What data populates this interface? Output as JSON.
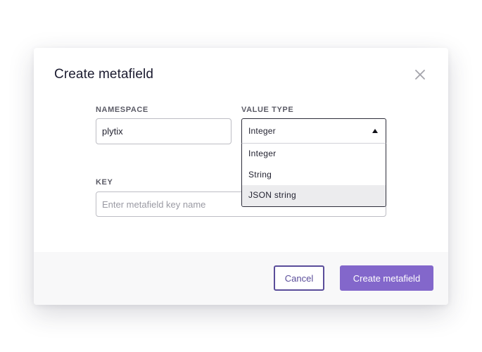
{
  "modal": {
    "title": "Create metafield"
  },
  "form": {
    "namespace": {
      "label": "NAMESPACE",
      "value": "plytix"
    },
    "value_type": {
      "label": "VALUE TYPE",
      "selected": "Integer",
      "options": [
        "Integer",
        "String",
        "JSON string"
      ],
      "highlighted_option": "JSON string"
    },
    "key": {
      "label": "KEY",
      "placeholder": "Enter metafield key name"
    }
  },
  "footer": {
    "cancel_label": "Cancel",
    "create_label": "Create metafield"
  },
  "icons": {
    "close": "close-icon",
    "caret": "caret-up-icon"
  },
  "colors": {
    "primary": "#8367cb",
    "secondary_border": "#5a4d9a",
    "footer_bg": "#f8f8f9",
    "highlight_bg": "#ececee"
  }
}
